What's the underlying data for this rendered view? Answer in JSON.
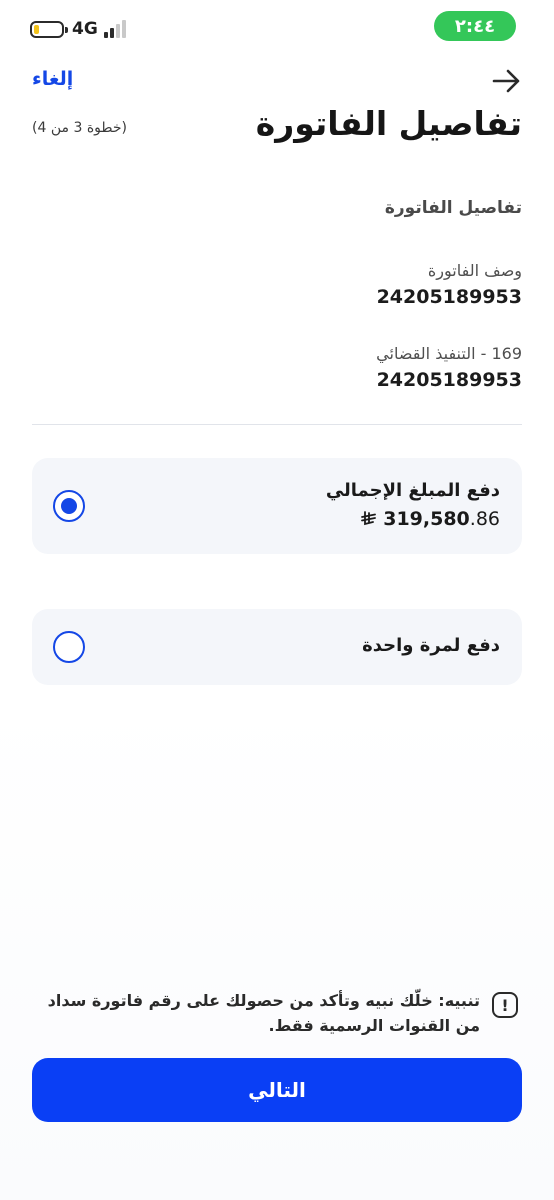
{
  "status_bar": {
    "time": "٢:٤٤",
    "network": "4G",
    "battery_level": 0.2,
    "signal_bars_active": 2,
    "clock_color": "#34c759"
  },
  "header": {
    "back_icon": "arrow-right-icon",
    "cancel_label": "إلغاء",
    "title": "تفاصيل الفاتورة",
    "step": "(خطوة 3 من 4)"
  },
  "details": {
    "section_title": "تفاصيل الفاتورة",
    "items": [
      {
        "label": "وصف الفاتورة",
        "value": "24205189953"
      },
      {
        "label": "169 - التنفيذ القضائي",
        "value": "24205189953"
      }
    ]
  },
  "payment_options": [
    {
      "title": "دفع المبلغ الإجمالي",
      "amount_int": "319,580",
      "amount_dec": ".86",
      "currency_icon": "riyal-symbol-icon",
      "selected": true
    },
    {
      "title": "دفع لمرة واحدة",
      "selected": false
    }
  ],
  "footer": {
    "warning_icon": "exclamation-icon",
    "warning_text": "تنبيه: خلّك نبيه وتأكد من حصولك على رقم فاتورة سداد من القنوات الرسمية فقط.",
    "next_label": "التالي"
  },
  "colors": {
    "accent": "#1447e6",
    "button": "#0a3ff5",
    "card_bg": "#f4f6fa"
  }
}
